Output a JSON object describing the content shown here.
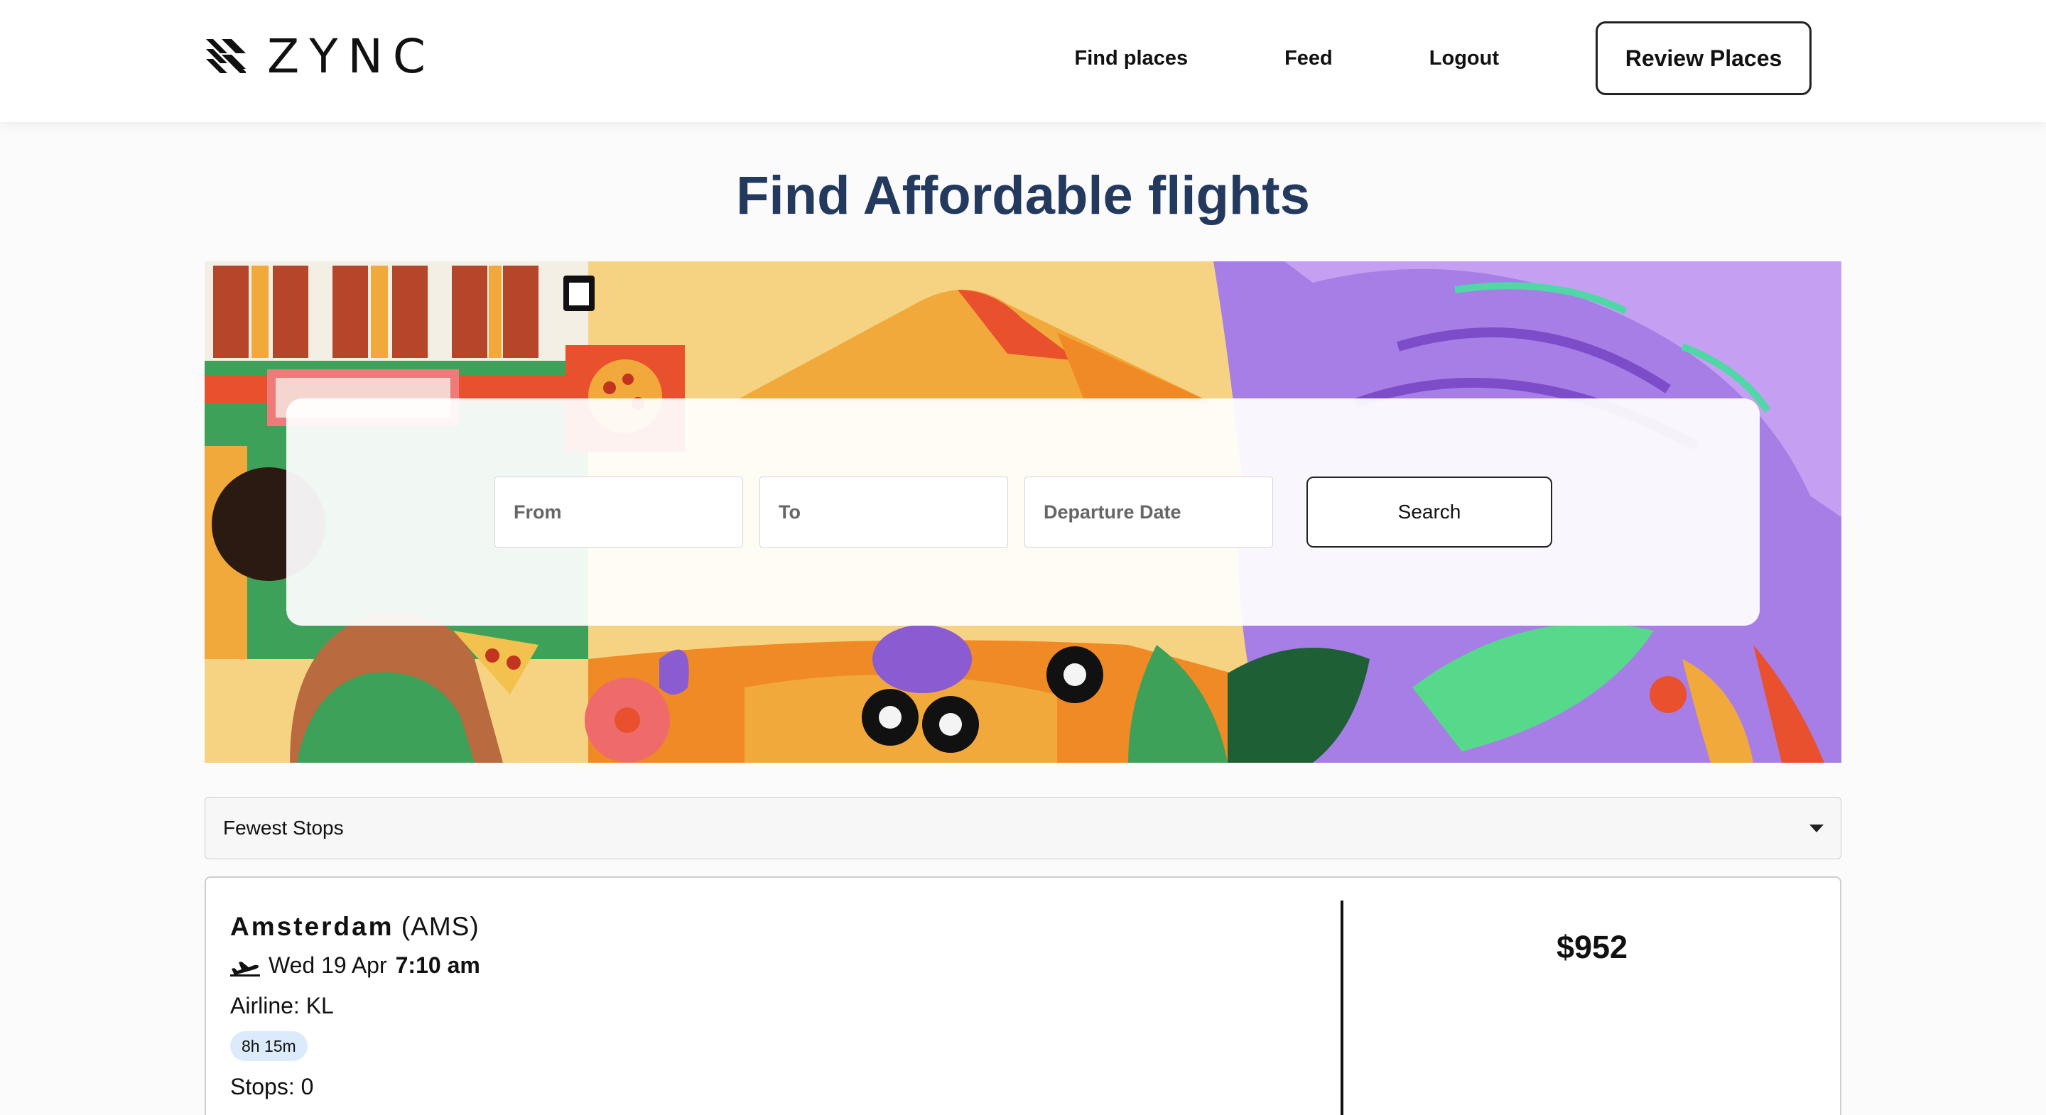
{
  "header": {
    "logo_text": "ZYNC",
    "nav": [
      "Find places",
      "Feed",
      "Logout"
    ],
    "cta_label": "Review Places"
  },
  "page_title": "Find Affordable flights",
  "search": {
    "from_placeholder": "From",
    "to_placeholder": "To",
    "date_placeholder": "Departure Date",
    "button_label": "Search"
  },
  "sort": {
    "selected": "Fewest Stops"
  },
  "results": [
    {
      "city": "Amsterdam",
      "code": "(AMS)",
      "date": "Wed 19 Apr",
      "time": "7:10 am",
      "airline": "Airline: KL",
      "duration": "8h 15m",
      "stops": "Stops: 0",
      "price": "$952"
    }
  ],
  "colors": {
    "title": "#23395d",
    "badge_bg": "#dcebfb",
    "hero_purple": "#9b6bdc",
    "hero_orange": "#f08a24",
    "hero_green": "#3ea15a"
  },
  "icons": [
    "zync-logo-icon",
    "plane-takeoff-icon",
    "chevron-down-icon"
  ]
}
